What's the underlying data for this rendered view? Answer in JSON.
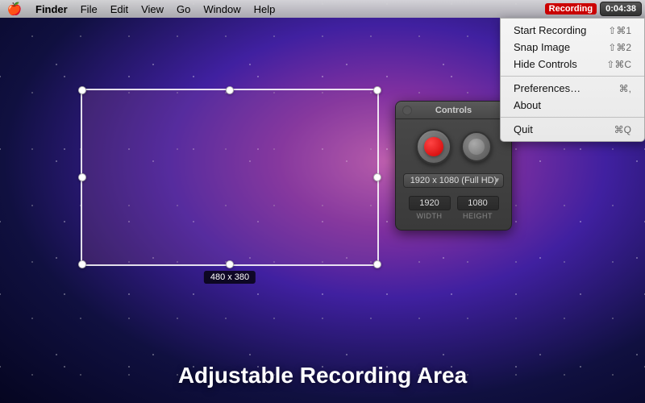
{
  "menubar": {
    "apple": "🍎",
    "items": [
      "Finder",
      "File",
      "Edit",
      "View",
      "Go",
      "Window",
      "Help"
    ],
    "recording_label": "Recording",
    "time": "0:04:38"
  },
  "dropdown": {
    "items": [
      {
        "label": "Start Recording",
        "shortcut": "⇧⌘1"
      },
      {
        "label": "Snap Image",
        "shortcut": "⇧⌘2"
      },
      {
        "label": "Hide Controls",
        "shortcut": "⇧⌘C"
      },
      {
        "label": "Preferences…",
        "shortcut": "⌘,"
      },
      {
        "label": "About",
        "shortcut": ""
      },
      {
        "label": "Quit",
        "shortcut": "⌘Q"
      }
    ]
  },
  "recording_area": {
    "dimension_label": "480 x 380"
  },
  "controls": {
    "title": "Controls",
    "resolution_value": "1920 x 1080 (Full HD)",
    "width_value": "1920",
    "height_value": "1080",
    "width_label": "WIDTH",
    "height_label": "HEIGHT"
  },
  "page": {
    "bottom_title": "Adjustable Recording Area"
  }
}
